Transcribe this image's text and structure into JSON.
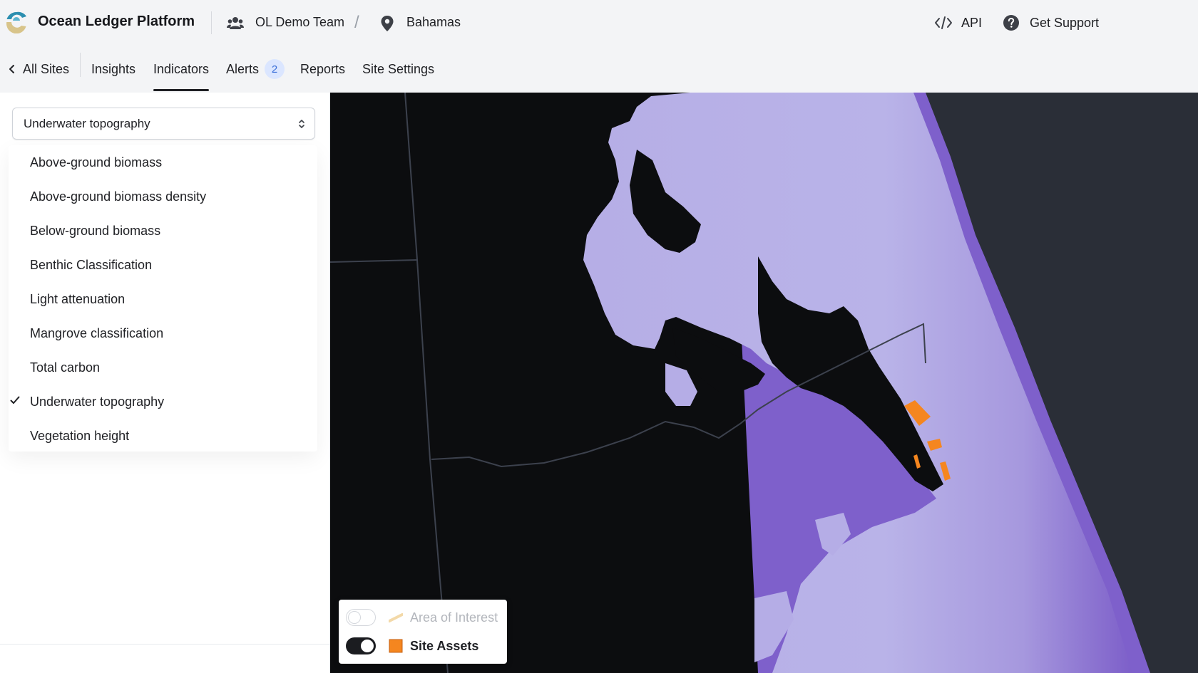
{
  "app": {
    "title": "Ocean Ledger Platform",
    "logo_icon": "ocean-ledger-logo-icon"
  },
  "header": {
    "team": "OL Demo Team",
    "team_icon": "users-icon",
    "separator": "/",
    "site": "Bahamas",
    "site_icon": "map-pin-icon",
    "api_label": "API",
    "api_icon": "code-icon",
    "support_label": "Get Support",
    "support_icon": "help-circle-icon"
  },
  "nav": {
    "back_label": "All Sites",
    "tabs": [
      {
        "label": "Insights",
        "active": false
      },
      {
        "label": "Indicators",
        "active": true
      },
      {
        "label": "Alerts",
        "active": false,
        "badge": "2"
      },
      {
        "label": "Reports",
        "active": false
      },
      {
        "label": "Site Settings",
        "active": false
      }
    ]
  },
  "indicator_select": {
    "value": "Underwater topography",
    "options": [
      {
        "label": "Above-ground biomass",
        "selected": false
      },
      {
        "label": "Above-ground biomass density",
        "selected": false
      },
      {
        "label": "Below-ground biomass",
        "selected": false
      },
      {
        "label": "Benthic Classification",
        "selected": false
      },
      {
        "label": "Light attenuation",
        "selected": false
      },
      {
        "label": "Mangrove classification",
        "selected": false
      },
      {
        "label": "Total carbon",
        "selected": false
      },
      {
        "label": "Underwater topography",
        "selected": true
      },
      {
        "label": "Vegetation height",
        "selected": false
      }
    ]
  },
  "legend": {
    "layers": [
      {
        "label": "Area of Interest",
        "enabled": false,
        "color": "#f3d9a8"
      },
      {
        "label": "Site Assets",
        "enabled": true,
        "color": "#f5861f"
      }
    ]
  },
  "colors": {
    "accent": "#1f2024",
    "badge_bg": "#dbe6ff",
    "badge_text": "#3b6fd8",
    "asset_orange": "#f5861f",
    "bathymetry_light": "#b7b0e6",
    "bathymetry_deep": "#7d5fc9",
    "land": "#0c0d0f"
  }
}
